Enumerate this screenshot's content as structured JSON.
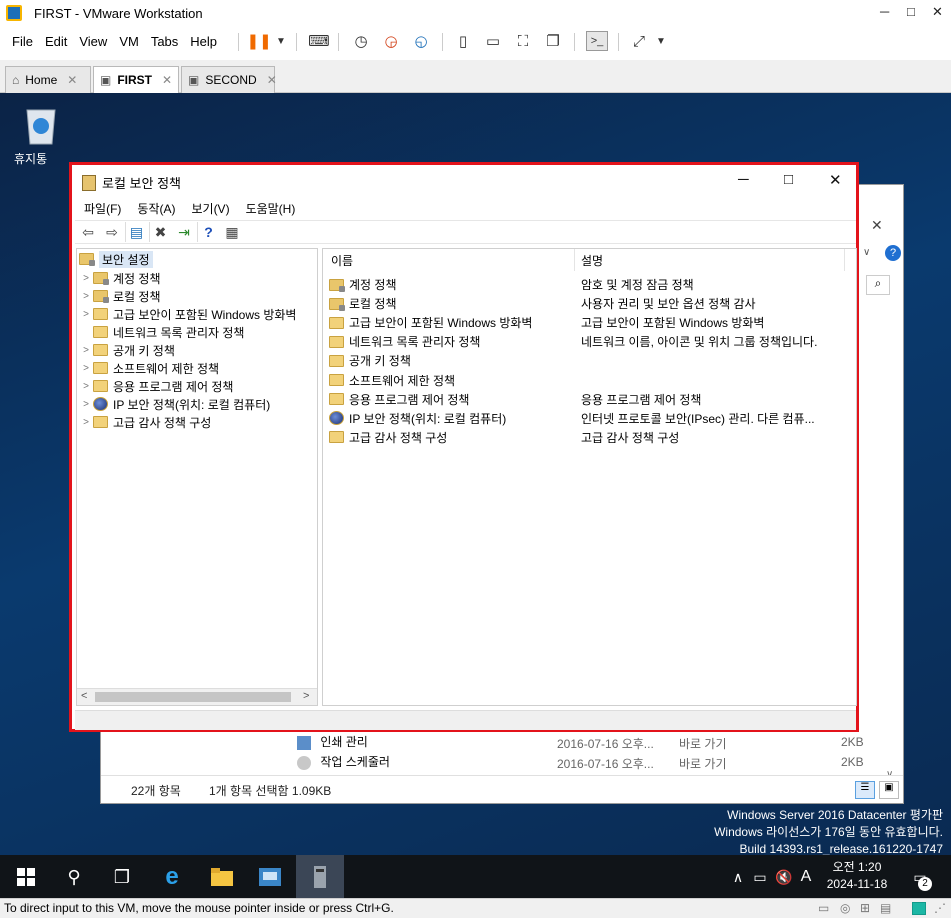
{
  "vmware": {
    "title": "FIRST - VMware Workstation",
    "menu": [
      "File",
      "Edit",
      "View",
      "VM",
      "Tabs",
      "Help"
    ],
    "tabs": [
      {
        "label": "Home",
        "active": false
      },
      {
        "label": "FIRST",
        "active": true
      },
      {
        "label": "SECOND",
        "active": false
      }
    ],
    "status_text": "To direct input to this VM, move the mouse pointer inside or press Ctrl+G."
  },
  "desktop": {
    "recycle_label": "휴지통",
    "watermark": {
      "line1": "Windows Server 2016 Datacenter 평가판",
      "line2": "Windows 라이선스가 176일 동안 유효합니다.",
      "line3": "Build 14393.rs1_release.161220-1747"
    }
  },
  "background_window": {
    "rows": [
      {
        "name": "인쇄 관리",
        "date": "2016-07-16 오후...",
        "type": "바로 가기",
        "size": "2KB"
      },
      {
        "name": "작업 스케줄러",
        "date": "2016-07-16 오후...",
        "type": "바로 가기",
        "size": "2KB"
      }
    ],
    "status_count": "22개 항목",
    "status_selected": "1개 항목 선택함 1.09KB"
  },
  "sec_window": {
    "title": "로컬 보안 정책",
    "menu": [
      "파일(F)",
      "동작(A)",
      "보기(V)",
      "도움말(H)"
    ],
    "tree_root": "보안 설정",
    "tree": [
      {
        "label": "계정 정책",
        "icon": "lock-folder",
        "expander": true
      },
      {
        "label": "로컬 정책",
        "icon": "lock-folder",
        "expander": true
      },
      {
        "label": "고급 보안이 포함된 Windows 방화벽",
        "icon": "folder",
        "expander": true
      },
      {
        "label": "네트워크 목록 관리자 정책",
        "icon": "folder",
        "expander": false
      },
      {
        "label": "공개 키 정책",
        "icon": "folder",
        "expander": true
      },
      {
        "label": "소프트웨어 제한 정책",
        "icon": "folder",
        "expander": true
      },
      {
        "label": "응용 프로그램 제어 정책",
        "icon": "folder",
        "expander": true
      },
      {
        "label": "IP 보안 정책(위치: 로컬 컴퓨터)",
        "icon": "ip",
        "expander": true
      },
      {
        "label": "고급 감사 정책 구성",
        "icon": "folder",
        "expander": true
      }
    ],
    "columns": {
      "name": "이름",
      "desc": "설명"
    },
    "rows": [
      {
        "name": "계정 정책",
        "desc": "암호 및 계정 잠금 정책",
        "icon": "lock-folder"
      },
      {
        "name": "로컬 정책",
        "desc": "사용자 권리 및 보안 옵션 정책 감사",
        "icon": "lock-folder"
      },
      {
        "name": "고급 보안이 포함된 Windows 방화벽",
        "desc": "고급 보안이 포함된 Windows 방화벽",
        "icon": "folder"
      },
      {
        "name": "네트워크 목록 관리자 정책",
        "desc": "네트워크 이름, 아이콘 및 위치 그룹 정책입니다.",
        "icon": "folder"
      },
      {
        "name": "공개 키 정책",
        "desc": "",
        "icon": "folder"
      },
      {
        "name": "소프트웨어 제한 정책",
        "desc": "",
        "icon": "folder"
      },
      {
        "name": "응용 프로그램 제어 정책",
        "desc": "응용 프로그램 제어 정책",
        "icon": "folder"
      },
      {
        "name": "IP 보안 정책(위치: 로컬 컴퓨터)",
        "desc": "인터넷 프로토콜 보안(IPsec) 관리. 다른 컴퓨...",
        "icon": "ip"
      },
      {
        "name": "고급 감사 정책 구성",
        "desc": "고급 감사 정책 구성",
        "icon": "folder"
      }
    ]
  },
  "taskbar": {
    "time": "오전 1:20",
    "date": "2024-11-18",
    "ime": "A",
    "notifications": "2"
  },
  "colors": {
    "highlight": "#e3131b",
    "desktop": "#0a3a6e",
    "taskbar": "#101418"
  }
}
